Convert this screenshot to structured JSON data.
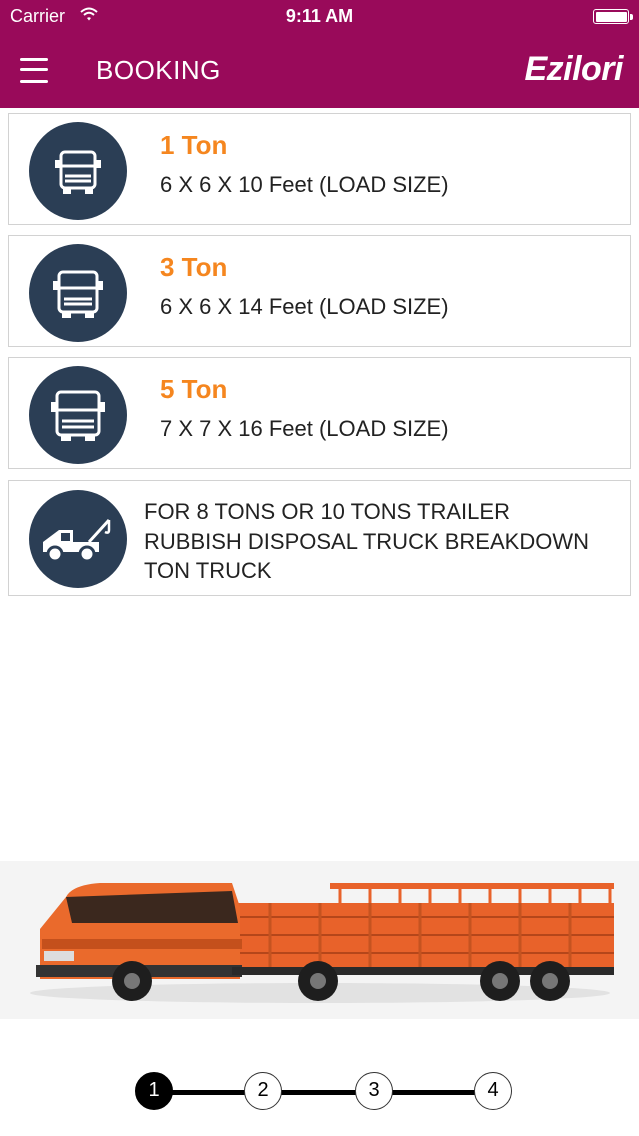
{
  "status_bar": {
    "carrier": "Carrier",
    "time": "9:11 AM"
  },
  "header": {
    "title": "BOOKING",
    "logo": "Ezilori"
  },
  "colors": {
    "header_bg": "#990a5a",
    "accent": "#f5861f",
    "icon_bg": "#2b3e55"
  },
  "options": [
    {
      "ton": "1 Ton",
      "size": "6 X 6 X 10 Feet (LOAD SIZE)",
      "icon": "truck-front-icon"
    },
    {
      "ton": "3 Ton",
      "size": "6 X 6 X 14 Feet (LOAD SIZE)",
      "icon": "truck-front-icon"
    },
    {
      "ton": "5 Ton",
      "size": "7 X 7 X 16 Feet (LOAD SIZE)",
      "icon": "truck-front-icon"
    }
  ],
  "other_option": {
    "line1": "FOR 8 TONS OR 10 TONS TRAILER",
    "line2": "RUBBISH DISPOSAL TRUCK BREAKDOWN",
    "line3": "TON TRUCK",
    "icon": "tow-truck-icon"
  },
  "steps": [
    "1",
    "2",
    "3",
    "4"
  ],
  "active_step": "1"
}
